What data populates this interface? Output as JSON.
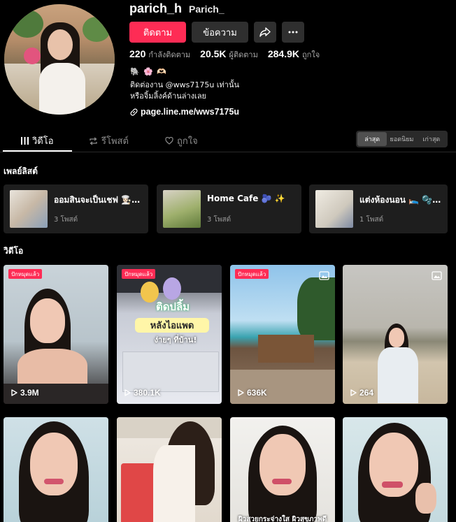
{
  "profile": {
    "username": "parich_h",
    "nickname": "Parich_",
    "follow_label": "ติดตาม",
    "message_label": "ข้อความ",
    "stats": [
      {
        "value": "220",
        "label": "กำลังติดตาม"
      },
      {
        "value": "20.5K",
        "label": "ผู้ติดตาม"
      },
      {
        "value": "284.9K",
        "label": "ถูกใจ"
      }
    ],
    "bio_emoji": "🐘 🌸 🫶🏻",
    "bio_line1": "ติดต่องาน @wws7175u เท่านั้น",
    "bio_line2": "หรือจิ้มลิ้งค์ด้านล่างเลย",
    "link": "page.line.me/wws7175u"
  },
  "tabs": {
    "videos": "วิดีโอ",
    "reposts": "รีโพสต์",
    "liked": "ถูกใจ"
  },
  "sort": [
    "ล่าสุด",
    "ยอดนิยม",
    "เก่าสุด"
  ],
  "playlists": {
    "title": "เพลย์ลิสต์",
    "items": [
      {
        "title": "ออมสินจะเป็นเชฟ 👩🏻‍🍳 ...",
        "count": "3 โพสต์"
      },
      {
        "title": "Home Cafe 🫐 ✨",
        "count": "3 โพสต์"
      },
      {
        "title": "แต่งห้องนอน 🛌 🫧 ...",
        "count": "1 โพสต์"
      }
    ]
  },
  "videos": {
    "title": "วิดีโอ",
    "pinned_label": "ปักหมุดแล้ว",
    "items": [
      {
        "views": "3.9M",
        "pinned": true
      },
      {
        "views": "380.1K",
        "pinned": true,
        "overlay_line1": "ติดปลิ้ม",
        "overlay_line2": "หลังไอแพด",
        "overlay_line3": "ง่ายๆ ที่บ้าน!"
      },
      {
        "views": "636K",
        "pinned": true
      },
      {
        "views": "264",
        "pinned": false
      },
      {
        "views": "",
        "pinned": false
      },
      {
        "views": "",
        "pinned": false
      },
      {
        "views": "",
        "pinned": false,
        "overlay_line1": "ผิวสวยกระจ่างใส ผิวสุขภาพดี"
      },
      {
        "views": "",
        "pinned": false
      }
    ]
  },
  "colors": {
    "accent": "#fe2c55",
    "background": "#000000",
    "card": "#1e1e1e"
  }
}
